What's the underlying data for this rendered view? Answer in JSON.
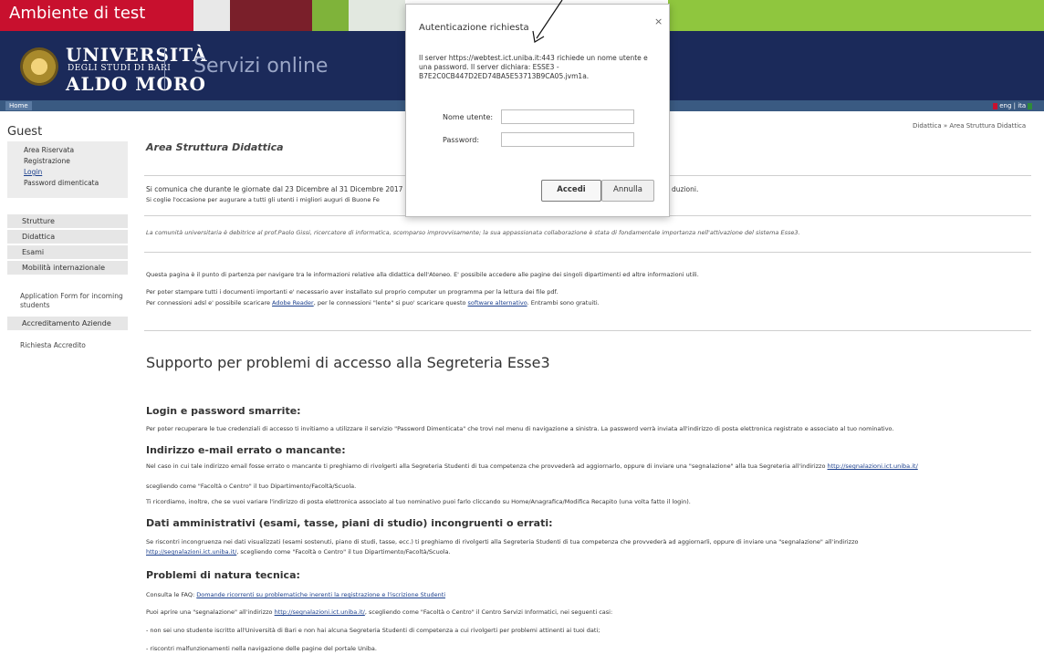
{
  "testbar": {
    "title": "Ambiente di test"
  },
  "header": {
    "logo_name": "UNIVERSITÀ",
    "logo_sub": "DEGLI STUDI DI BARI",
    "logo_name2": "ALDO MORO",
    "section_title": "Servizi online"
  },
  "nav": {
    "home": "Home",
    "lang": "eng | ita"
  },
  "sidebar": {
    "guest": "Guest",
    "area_riservata": "Area Riservata",
    "registrazione": "Registrazione",
    "login": "Login",
    "password_dimenticata": "Password dimenticata",
    "strutture": "Strutture",
    "didattica": "Didattica",
    "esami": "Esami",
    "mobilita": "Mobilità internazionale",
    "application_form_1": "Application Form for incoming",
    "application_form_2": "students",
    "accreditamento": "Accreditamento Aziende",
    "richiesta_accredito": "Richiesta Accredito"
  },
  "breadcrumb": "Didattica » Area Struttura Didattica",
  "main": {
    "title": "Area Struttura Didattica",
    "notice_1": "Si comunica che durante le giornate dal 23 Dicembre al 31 Dicembre 2017",
    "notice_1_end": "duzioni.",
    "notice_2": "Si coglie l'occasione per augurare a tutti gli utenti i migliori auguri di Buone Fe",
    "tribute": "La comunità universitaria è debitrice al prof.Paolo Gissi, ricercatore di informatica, scomparso improvvisamente; la sua appassionata collaborazione è stata di fondamentale importanza nell'attivazione del sistema Esse3.",
    "intro": "Questa pagina è il punto di partenza per navigare tra le informazioni relative alla didattica dell'Ateneo. E' possibile accedere alle pagine dei singoli dipartimenti ed altre informazioni utili.",
    "print_1": "Per poter stampare tutti i documenti importanti e' necessario aver installato sul proprio computer un programma per la lettura dei file pdf.",
    "print_2a": "Per connessioni adsl e' possibile scaricare ",
    "print_2_link1": "Adobe Reader",
    "print_2b": ", per le connessioni \"lente\" si puo' scaricare questo ",
    "print_2_link2": "software alternativo",
    "print_2c": ". Entrambi sono gratuiti.",
    "support_title": "Supporto per problemi di accesso alla Segreteria Esse3",
    "sec_login": "Login e password smarrite:",
    "login_text": "Per poter recuperare le tue credenziali di accesso ti invitiamo a utilizzare il servizio \"Password Dimenticata\" che trovi nel menu di navigazione a sinistra. La password verrà inviata all'indirizzo di posta elettronica registrato e associato al tuo nominativo.",
    "sec_email": "Indirizzo e-mail errato o mancante:",
    "email_text_1": "Nel caso in cui tale indirizzo email fosse errato o mancante ti preghiamo di rivolgerti alla Segreteria Studenti di tua competenza che provvederà ad aggiornarlo, oppure di inviare una \"segnalazione\" alla tua Segreteria all'indirizzo ",
    "email_link": "http://segnalazioni.ict.uniba.it/",
    "email_text_2": "scegliendo come \"Facoltà o Centro\" il tuo Dipartimento/Facoltà/Scuola.",
    "email_text_3": "Ti ricordiamo, inoltre, che se vuoi variare l'indirizzo di posta elettronica associato al tuo nominativo puoi farlo cliccando su Home/Anagrafica/Modifica Recapito (una volta fatto il login).",
    "sec_dati": "Dati amministrativi (esami, tasse, piani di studio) incongruenti o errati:",
    "dati_text_1": "Se riscontri incongruenza nei dati visualizzati (esami sostenuti, piano di studi, tasse, ecc.) ti preghiamo di rivolgerti alla Segreteria Studenti di tua competenza che provvederà ad aggiornarli, oppure di inviare una \"segnalazione\" all'indirizzo",
    "dati_link": "http://segnalazioni.ict.uniba.it/",
    "dati_text_2": ", scegliendo come \"Facoltà o Centro\" il tuo Dipartimento/Facoltà/Scuola.",
    "sec_tecnica": "Problemi di natura tecnica:",
    "faq_pre": "Consulta le FAQ: ",
    "faq_link": "Domande ricorrenti su problematiche inerenti la registrazione e l'iscrizione Studenti",
    "tec_1a": "Puoi aprire una \"segnalazione\" all'indirizzo ",
    "tec_1_link": "http://segnalazioni.ict.uniba.it/",
    "tec_1b": ", scegliendo come \"Facoltà o Centro\" il Centro Servizi Informatici, nei seguenti casi:",
    "tec_2": "- non sei uno studente iscritto all'Università di Bari e non hai alcuna Segreteria Studenti di competenza a cui rivolgerti per problemi attinenti ai tuoi dati;",
    "tec_3": "- riscontri malfunzionamenti nella navigazione delle pagine del portale Uniba."
  },
  "dialog": {
    "title": "Autenticazione richiesta",
    "close": "×",
    "message": "Il server https://webtest.ict.uniba.it:443 richiede un nome utente e una password. Il server dichiara: ESSE3 - B7E2C0CB447D2ED74BA5E53713B9CA05.jvm1a.",
    "username_label": "Nome utente:",
    "username_value": "",
    "password_label": "Password:",
    "password_value": "",
    "login_button": "Accedi",
    "cancel_button": "Annulla"
  },
  "colors": {
    "test_red": "#c8102e",
    "header_navy": "#1b2a5a",
    "nav_blue": "#3a5a82",
    "link_blue": "#1a3e8c"
  }
}
